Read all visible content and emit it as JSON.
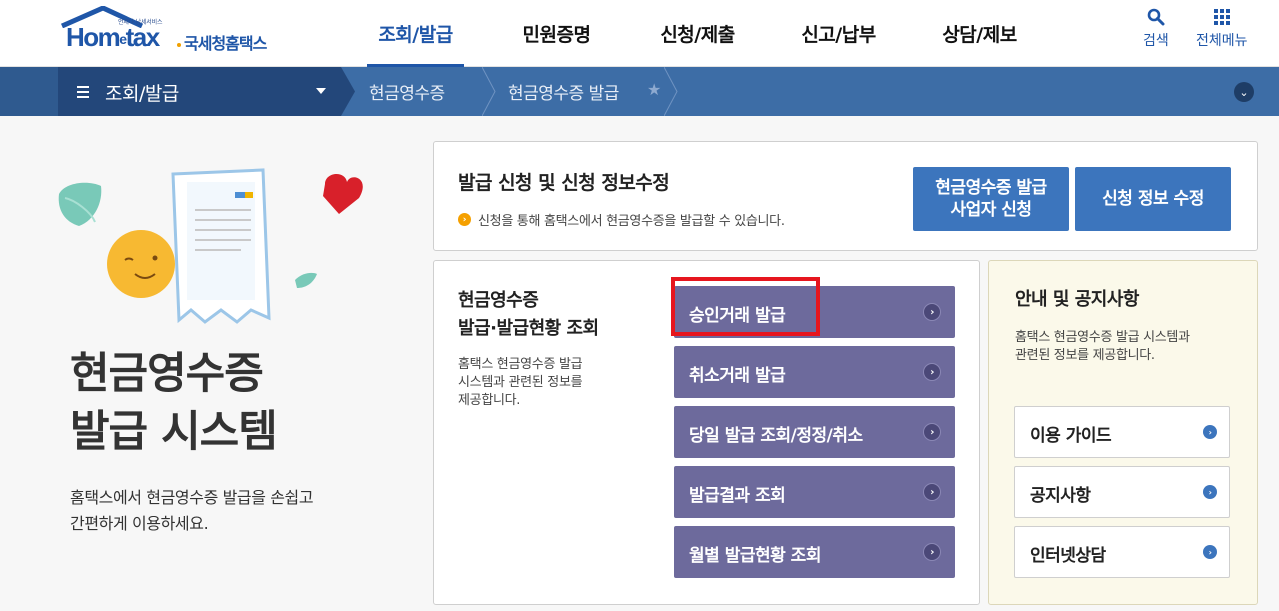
{
  "header": {
    "logo": {
      "tagline": "언제나 납세서비스",
      "brand_main": "Hom",
      "brand_e": "e",
      "brand_end": "tax",
      "brand_sub": "국세청홈택스"
    },
    "nav": [
      {
        "label": "조회/발급",
        "active": true
      },
      {
        "label": "민원증명",
        "active": false
      },
      {
        "label": "신청/제출",
        "active": false
      },
      {
        "label": "신고/납부",
        "active": false
      },
      {
        "label": "상담/제보",
        "active": false
      }
    ],
    "search_label": "검색",
    "all_menu_label": "전체메뉴"
  },
  "location_bar": {
    "menu_label": "조회/발급",
    "crumbs": [
      "현금영수증",
      "현금영수증 발급"
    ],
    "star_icon": "star-icon"
  },
  "hero": {
    "title_line1": "현금영수증",
    "title_line2": "발급 시스템",
    "desc_line1": "홈택스에서 현금영수증 발급을 손쉽고",
    "desc_line2": "간편하게 이용하세요."
  },
  "apply_card": {
    "title": "발급 신청 및 신청 정보수정",
    "note": "신청을 통해 홈택스에서 현금영수증을 발급할 수 있습니다.",
    "apply_button": "현금영수증 발급\n사업자 신청",
    "edit_button": "신청 정보 수정"
  },
  "query_card": {
    "title": "현금영수증\n발급·발급현황 조회",
    "desc": "홈택스 현금영수증 발급\n시스템과 관련된 정보를\n제공합니다.",
    "buttons": [
      "승인거래 발급",
      "취소거래 발급",
      "당일 발급 조회/정정/취소",
      "발급결과 조회",
      "월별 발급현황 조회"
    ]
  },
  "notice_card": {
    "title": "안내 및 공지사항",
    "desc": "홈택스 현금영수증 발급 시스템과\n관련된 정보를 제공합니다.",
    "buttons": [
      "이용 가이드",
      "공지사항",
      "인터넷상담"
    ]
  },
  "colors": {
    "brand_blue": "#1f56a8",
    "location_bar": "#3d6da6",
    "menu_box": "#23477a",
    "purple_button": "#6d6a9c",
    "highlight_red": "#e6161e",
    "notice_bg": "#fbf9ea"
  }
}
